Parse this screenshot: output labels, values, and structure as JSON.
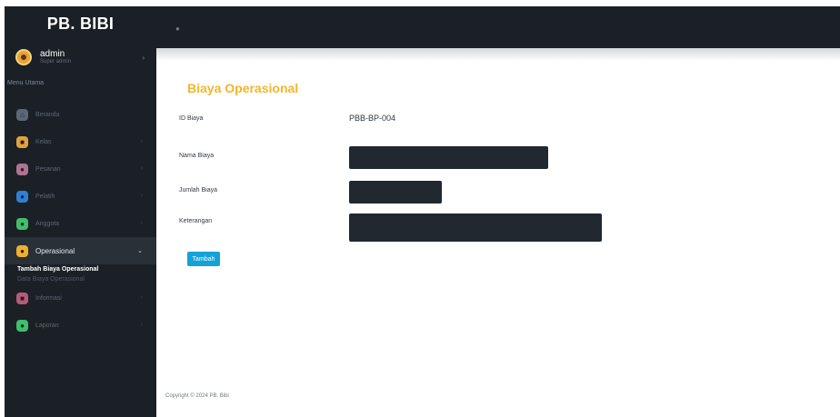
{
  "brand": {
    "name": "PB. BIBI"
  },
  "user": {
    "name": "admin",
    "role": "Super admin"
  },
  "sidebar": {
    "section_title": "Menu Utama",
    "items": [
      {
        "label": "Beranda",
        "color": "#5c6675",
        "icon": "home-icon"
      },
      {
        "label": "Kelas",
        "color": "#e1a23a",
        "icon": "class-icon"
      },
      {
        "label": "Pesanan",
        "color": "#b0748f",
        "icon": "order-icon"
      },
      {
        "label": "Pelatih",
        "color": "#2f7fd6",
        "icon": "coach-icon"
      },
      {
        "label": "Anggota",
        "color": "#3fbf6a",
        "icon": "member-icon"
      },
      {
        "label": "Operasional",
        "color": "#f0b02b",
        "icon": "operational-icon"
      },
      {
        "label": "Informasi",
        "color": "#b85a7a",
        "icon": "info-icon"
      },
      {
        "label": "Laporan",
        "color": "#3fbf6a",
        "icon": "report-icon"
      }
    ],
    "operasional_sub": [
      {
        "label": "Tambah Biaya Operasional"
      },
      {
        "label": "Data Biaya Operasional"
      }
    ]
  },
  "form": {
    "title": "Biaya Operasional",
    "id_label": "ID Biaya",
    "id_value": "PBB-BP-004",
    "name_label": "Nama Biaya",
    "amount_label": "Jumlah Biaya",
    "desc_label": "Keterangan",
    "submit_label": "Tambah"
  },
  "footer": {
    "text": "Copyright © 2024 PB. Bibi"
  }
}
